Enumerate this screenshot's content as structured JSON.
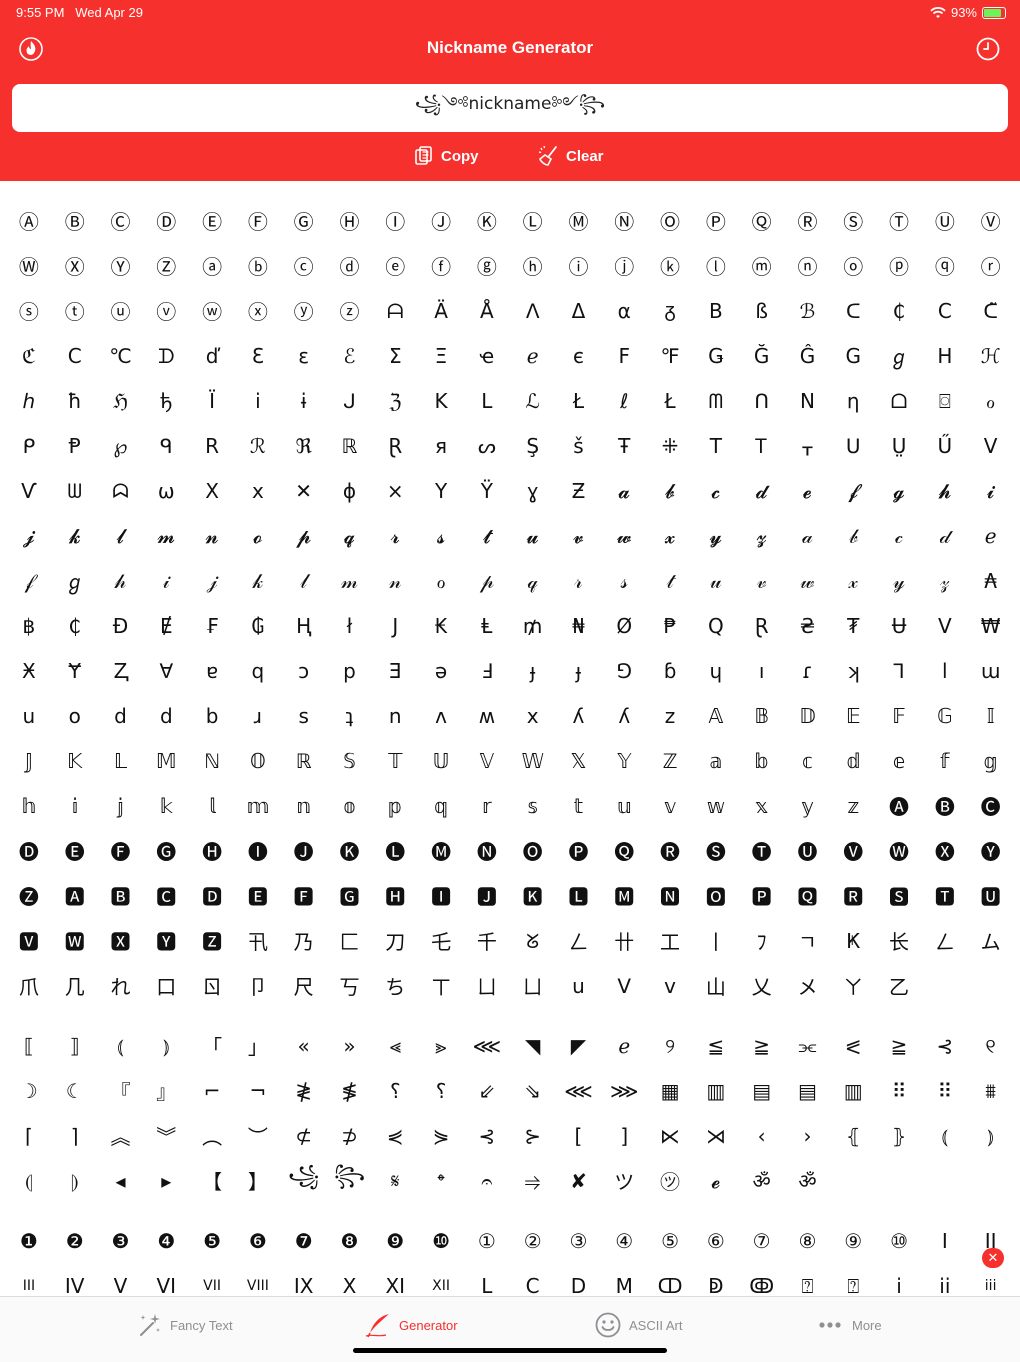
{
  "status": {
    "time": "9:55 PM",
    "date": "Wed Apr 29",
    "battery": "93%"
  },
  "header": {
    "title": "Nickname Generator",
    "left_icon": "flame-icon",
    "right_icon": "history-clock-icon"
  },
  "input": {
    "value": "꧁༺nickname༻꧂"
  },
  "actions": {
    "copy_label": "Copy",
    "clear_label": "Clear"
  },
  "colors": {
    "accent": "#f5302d",
    "inactive": "#8e8e93",
    "battery": "#6cf25b"
  },
  "symbols_section1": [
    "Ⓐ",
    "Ⓑ",
    "Ⓒ",
    "Ⓓ",
    "Ⓔ",
    "Ⓕ",
    "Ⓖ",
    "Ⓗ",
    "Ⓘ",
    "Ⓙ",
    "Ⓚ",
    "Ⓛ",
    "Ⓜ",
    "Ⓝ",
    "Ⓞ",
    "Ⓟ",
    "Ⓠ",
    "Ⓡ",
    "Ⓢ",
    "Ⓣ",
    "Ⓤ",
    "Ⓥ",
    "Ⓦ",
    "Ⓧ",
    "Ⓨ",
    "Ⓩ",
    "ⓐ",
    "ⓑ",
    "ⓒ",
    "ⓓ",
    "ⓔ",
    "ⓕ",
    "ⓖ",
    "ⓗ",
    "ⓘ",
    "ⓙ",
    "ⓚ",
    "ⓛ",
    "ⓜ",
    "ⓝ",
    "ⓞ",
    "ⓟ",
    "ⓠ",
    "ⓡ",
    "ⓢ",
    "ⓣ",
    "ⓤ",
    "ⓥ",
    "ⓦ",
    "ⓧ",
    "ⓨ",
    "ⓩ",
    "ᗩ",
    "Ä",
    "Å",
    "ᐱ",
    "Δ",
    "α",
    "ᵹ",
    "B",
    "ß",
    "ℬ",
    "ᑕ",
    "₵",
    "C",
    "ᑕ̃",
    "ℭ",
    "C",
    "℃",
    "ᗪ",
    "ď",
    "Ɛ",
    "ε",
    "ℰ",
    "Σ",
    "Ξ",
    "ҽ",
    "ℯ",
    "є",
    "F",
    "℉",
    "Ǥ",
    "Ğ",
    "Ĝ",
    "G",
    "ℊ",
    "H",
    "ℋ",
    "ℎ",
    "ħ",
    "ℌ",
    "ђ",
    "Ï",
    "i",
    "ɨ",
    "ᒍ",
    "ℨ",
    "K",
    "L",
    "ℒ",
    "Ł",
    "ℓ",
    "Ł",
    "ᗰ",
    "ᑎ",
    "N",
    "η",
    "ᗝ",
    "⌼",
    "ℴ",
    "ᑭ",
    "Ᵽ",
    "℘",
    "ᑫ",
    "R",
    "ℛ",
    "ℜ",
    "ℝ",
    "Ɽ",
    "я",
    "ᔕ",
    "Ş",
    "š",
    "Ŧ",
    "⁜",
    "T",
    "Ꭲ",
    "ᚁ",
    "ᑌ",
    "Ṳ",
    "Ű",
    "V",
    "Ѵ",
    "ᗯ",
    "ᗣ",
    "ω",
    "X",
    "x",
    "✕",
    "ɸ",
    "×",
    "Y",
    "Ÿ",
    "ɣ",
    "Ƶ",
    "𝓪",
    "𝓫",
    "𝓬",
    "𝓭",
    "𝓮",
    "𝓯",
    "𝓰",
    "𝓱",
    "𝓲",
    "𝓳",
    "𝓴",
    "𝓵",
    "𝓶",
    "𝓷",
    "𝓸",
    "𝓹",
    "𝓺",
    "𝓻",
    "𝓼",
    "𝓽",
    "𝓾",
    "𝓿",
    "𝔀",
    "𝔁",
    "𝔂",
    "𝔃",
    "𝒶",
    "𝒷",
    "𝒸",
    "𝒹",
    "ℯ",
    "𝒻",
    "ℊ",
    "𝒽",
    "𝒾",
    "𝒿",
    "𝓀",
    "𝓁",
    "𝓂",
    "𝓃",
    "ℴ",
    "𝓅",
    "𝓆",
    "𝓇",
    "𝓈",
    "𝓉",
    "𝓊",
    "𝓋",
    "𝓌",
    "𝓍",
    "𝓎",
    "𝓏",
    "₳",
    "฿",
    "₵",
    "Đ",
    "Ɇ",
    "₣",
    "₲",
    "Ⱨ",
    "ł",
    "J",
    "₭",
    "Ⱡ",
    "₥",
    "₦",
    "Ø",
    "₱",
    "Q",
    "Ɽ",
    "₴",
    "₮",
    "Ʉ",
    "V",
    "₩",
    "Ӿ",
    "Ɏ",
    "Ⱬ",
    "∀",
    "ɐ",
    "q",
    "ɔ",
    "p",
    "Ǝ",
    "ə",
    "Ⅎ",
    "ɟ",
    "ɟ",
    "⅁",
    "ɓ",
    "ɥ",
    "ı",
    "ɾ",
    "ʞ",
    "ꓶ",
    "l",
    "ɯ",
    "u",
    "o",
    "d",
    "d",
    "b",
    "ɹ",
    "s",
    "ʇ",
    "n",
    "ʌ",
    "ʍ",
    "x",
    "ʎ",
    "ʎ",
    "z",
    "𝔸",
    "𝔹",
    "𝔻",
    "𝔼",
    "𝔽",
    "𝔾",
    "𝕀",
    "𝕁",
    "𝕂",
    "𝕃",
    "𝕄",
    "ℕ",
    "𝕆",
    "ℝ",
    "𝕊",
    "𝕋",
    "𝕌",
    "𝕍",
    "𝕎",
    "𝕏",
    "𝕐",
    "ℤ",
    "𝕒",
    "𝕓",
    "𝕔",
    "𝕕",
    "𝕖",
    "𝕗",
    "𝕘",
    "𝕙",
    "𝕚",
    "𝕛",
    "𝕜",
    "𝕝",
    "𝕞",
    "𝕟",
    "𝕠",
    "𝕡",
    "𝕢",
    "𝕣",
    "𝕤",
    "𝕥",
    "𝕦",
    "𝕧",
    "𝕨",
    "𝕩",
    "𝕪",
    "𝕫",
    "🅐",
    "🅑",
    "🅒",
    "🅓",
    "🅔",
    "🅕",
    "🅖",
    "🅗",
    "🅘",
    "🅙",
    "🅚",
    "🅛",
    "🅜",
    "🅝",
    "🅞",
    "🅟",
    "🅠",
    "🅡",
    "🅢",
    "🅣",
    "🅤",
    "🅥",
    "🅦",
    "🅧",
    "🅨",
    "🅩",
    "🅰",
    "🅱",
    "🅲",
    "🅳",
    "🅴",
    "🅵",
    "🅶",
    "🅷",
    "🅸",
    "🅹",
    "🅺",
    "🅻",
    "🅼",
    "🅽",
    "🅾",
    "🅿",
    "🆀",
    "🆁",
    "🆂",
    "🆃",
    "🆄",
    "🆅",
    "🆆",
    "🆇",
    "🆈",
    "🆉",
    "卂",
    "乃",
    "匚",
    "刀",
    "乇",
    "千",
    "ᘜ",
    "ㄥ",
    "卄",
    "工",
    "丨",
    "ﾌ",
    "ㄱ",
    "Ҝ",
    "长",
    "ㄥ",
    "ム",
    "爪",
    "几",
    "れ",
    "口",
    "ㄖ",
    "卩",
    "尺",
    "丂",
    "ち",
    "ㄒ",
    "ㄩ",
    "ㄩ",
    "u",
    "ᐯ",
    "v",
    "山",
    "乂",
    "メ",
    "ㄚ",
    "乙"
  ],
  "symbols_section2": [
    "⟦",
    "⟧",
    "⦅",
    "⦆",
    "「",
    "」",
    "«",
    "»",
    "⪡",
    "⪢",
    "⋘",
    "◥",
    "◤",
    "ℯ",
    "୨",
    "≦",
    "≧",
    "⫘",
    "⪕",
    "≧",
    "⊰",
    "୧",
    "☽",
    "☾",
    "『",
    "』",
    "⌐",
    "¬",
    "≹",
    "≸",
    "⸮",
    "⸮",
    "⇙",
    "⇘",
    "⋘",
    "⋙",
    "▦",
    "▥",
    "▤",
    "▤",
    "▥",
    "⠿",
    "⠿",
    "⩩",
    "⌈",
    "⌉",
    "︽",
    "︾",
    "︵",
    "︶",
    "⊄",
    "⊅",
    "⋞",
    "⋟",
    "⊰",
    "⊱",
    "[",
    "]",
    "⋉",
    "⋊",
    "‹",
    "›",
    "⦃",
    "⦄",
    "⦅",
    "⦆",
    "⦇",
    "⦈",
    "◂",
    "▸",
    "【",
    "】",
    "꧁",
    "꧂",
    "𝄋",
    "𝄌",
    "𝄐",
    "⥤",
    "✘",
    "ツ",
    "㋡",
    "𝓮",
    "ॐ",
    "ॐ"
  ],
  "symbols_section3": [
    "❶",
    "❷",
    "❸",
    "❹",
    "❺",
    "❻",
    "❼",
    "❽",
    "❾",
    "❿",
    "①",
    "②",
    "③",
    "④",
    "⑤",
    "⑥",
    "⑦",
    "⑧",
    "⑨",
    "⑩",
    "I",
    "II",
    "III",
    "IV",
    "V",
    "VI",
    "VII",
    "VIII",
    "IX",
    "X",
    "XI",
    "XII",
    "L",
    "C",
    "D",
    "M",
    "ↀ",
    "ↁ",
    "ↂ",
    "⍰",
    "⍰",
    "i",
    "ii",
    "iii"
  ],
  "tabs": [
    {
      "label": "Fancy Text",
      "icon": "magic-wand-icon"
    },
    {
      "label": "Generator",
      "icon": "quill-pen-icon"
    },
    {
      "label": "ASCII Art",
      "icon": "smiley-face-icon"
    },
    {
      "label": "More",
      "icon": "ellipsis-icon"
    }
  ],
  "active_tab": "Generator"
}
